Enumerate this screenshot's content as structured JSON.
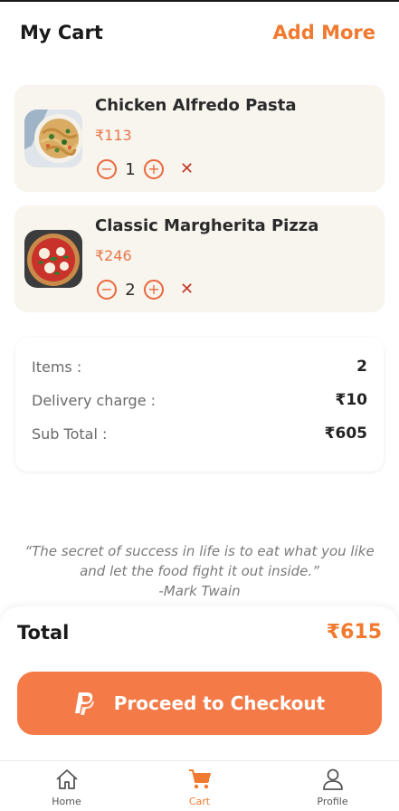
{
  "header": {
    "title": "My Cart",
    "add_more": "Add More"
  },
  "cart_items": [
    {
      "name": "Chicken Alfredo Pasta",
      "price": "₹113",
      "quantity": "1",
      "image": "pasta-thumbnail"
    },
    {
      "name": "Classic Margherita Pizza",
      "price": "₹246",
      "quantity": "2",
      "image": "pizza-thumbnail"
    }
  ],
  "summary": {
    "items_label": "Items :",
    "items_value": "2",
    "delivery_label": "Delivery charge :",
    "delivery_value": "₹10",
    "subtotal_label": "Sub Total :",
    "subtotal_value": "₹605"
  },
  "quote": {
    "text": "“The secret of success in life is to eat what you like and let the food fight it out inside.”",
    "author": "-Mark Twain"
  },
  "total": {
    "label": "Total",
    "value": "₹615"
  },
  "checkout": {
    "label": "Proceed to Checkout",
    "icon": "paypal-icon"
  },
  "nav": [
    {
      "label": "Home",
      "icon": "home-icon",
      "active": false
    },
    {
      "label": "Cart",
      "icon": "cart-icon",
      "active": true
    },
    {
      "label": "Profile",
      "icon": "profile-icon",
      "active": false
    }
  ],
  "colors": {
    "accent": "#f07a30",
    "button": "#f47a47",
    "remove": "#c0392b",
    "card_bg": "#f8f4ee"
  }
}
